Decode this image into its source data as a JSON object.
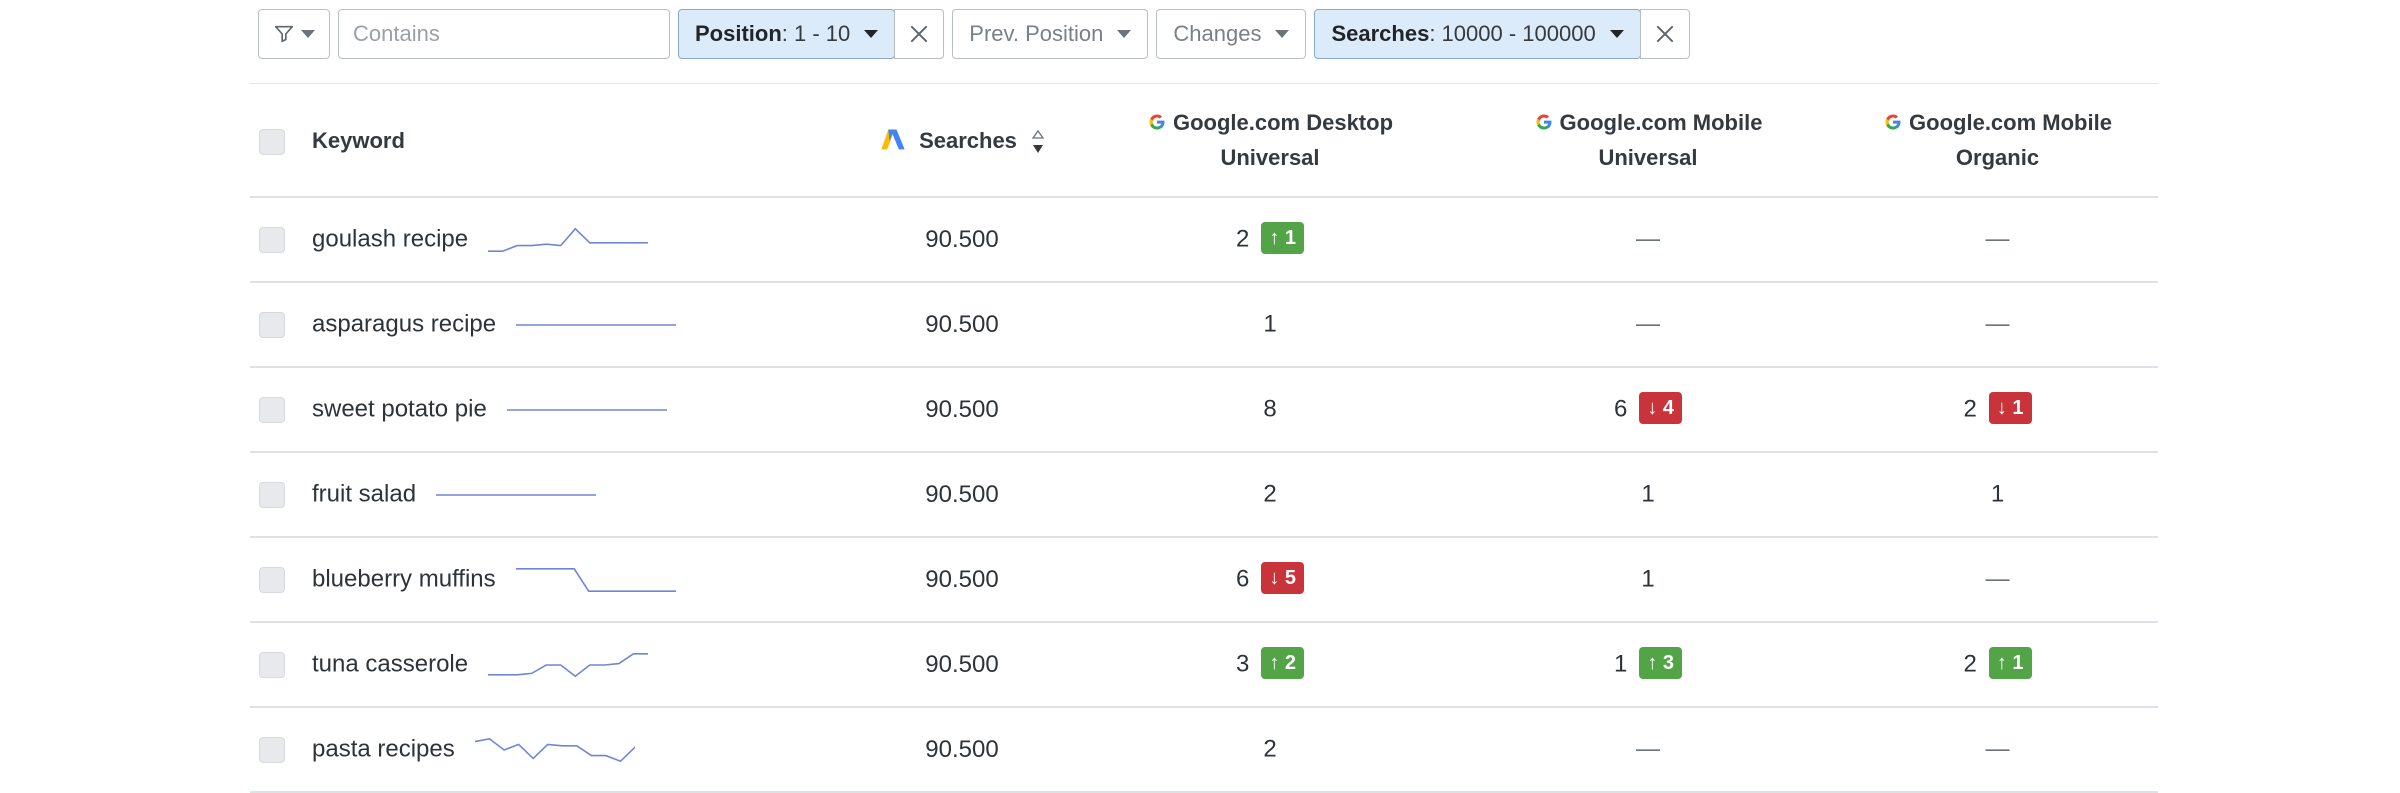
{
  "filters": {
    "contains_placeholder": "Contains",
    "position": {
      "label": "Position",
      "value": ": 1 - 10"
    },
    "prev_position": "Prev. Position",
    "changes": "Changes",
    "searches": {
      "label": "Searches",
      "value": ": 10000 - 100000"
    }
  },
  "columns": {
    "keyword": "Keyword",
    "searches": "Searches",
    "desktop_universal": [
      "Google.com Desktop",
      "Universal"
    ],
    "mobile_universal": [
      "Google.com Mobile",
      "Universal"
    ],
    "mobile_organic": [
      "Google.com Mobile",
      "Organic"
    ]
  },
  "rows": [
    {
      "keyword": "goulash recipe",
      "searches": "90.500",
      "desktop": {
        "pos": "2",
        "change": "1",
        "dir": "up"
      },
      "mobile": {
        "pos": "—"
      },
      "organic": {
        "pos": "—"
      },
      "trend": [
        0.1,
        0.1,
        0.3,
        0.3,
        0.35,
        0.3,
        0.9,
        0.4,
        0.4,
        0.4,
        0.4,
        0.4
      ]
    },
    {
      "keyword": "asparagus recipe",
      "searches": "90.500",
      "desktop": {
        "pos": "1"
      },
      "mobile": {
        "pos": "—"
      },
      "organic": {
        "pos": "—"
      },
      "trend": [
        0.5,
        0.5,
        0.5,
        0.5,
        0.5,
        0.5,
        0.5,
        0.5,
        0.5,
        0.5,
        0.5,
        0.5
      ]
    },
    {
      "keyword": "sweet potato pie",
      "searches": "90.500",
      "desktop": {
        "pos": "8"
      },
      "mobile": {
        "pos": "6",
        "change": "4",
        "dir": "down"
      },
      "organic": {
        "pos": "2",
        "change": "1",
        "dir": "down"
      },
      "trend": [
        0.5,
        0.5,
        0.5,
        0.5,
        0.5,
        0.5,
        0.5,
        0.5,
        0.5,
        0.5,
        0.5,
        0.5
      ]
    },
    {
      "keyword": "fruit salad",
      "searches": "90.500",
      "desktop": {
        "pos": "2"
      },
      "mobile": {
        "pos": "1"
      },
      "organic": {
        "pos": "1"
      },
      "trend": [
        0.5,
        0.5,
        0.5,
        0.5,
        0.5,
        0.5,
        0.5,
        0.5,
        0.5,
        0.5,
        0.5,
        0.5
      ]
    },
    {
      "keyword": "blueberry muffins",
      "searches": "90.500",
      "desktop": {
        "pos": "6",
        "change": "5",
        "dir": "down"
      },
      "mobile": {
        "pos": "1"
      },
      "organic": {
        "pos": "—"
      },
      "trend": [
        0.9,
        0.9,
        0.9,
        0.9,
        0.9,
        0.1,
        0.1,
        0.1,
        0.1,
        0.1,
        0.1,
        0.1
      ]
    },
    {
      "keyword": "tuna casserole",
      "searches": "90.500",
      "desktop": {
        "pos": "3",
        "change": "2",
        "dir": "up"
      },
      "mobile": {
        "pos": "1",
        "change": "3",
        "dir": "up"
      },
      "organic": {
        "pos": "2",
        "change": "1",
        "dir": "up"
      },
      "trend": [
        0.15,
        0.15,
        0.15,
        0.2,
        0.5,
        0.5,
        0.1,
        0.5,
        0.5,
        0.55,
        0.9,
        0.9
      ]
    },
    {
      "keyword": "pasta recipes",
      "searches": "90.500",
      "desktop": {
        "pos": "2"
      },
      "mobile": {
        "pos": "—"
      },
      "organic": {
        "pos": "—"
      },
      "trend": [
        0.8,
        0.9,
        0.5,
        0.7,
        0.2,
        0.7,
        0.65,
        0.65,
        0.3,
        0.3,
        0.1,
        0.6
      ]
    }
  ],
  "colors": {
    "up": "#52a447",
    "down": "#c9343b",
    "sparkline": "#6f86d6",
    "active_filter": "#dcebfa"
  },
  "icons": {
    "funnel": "filter-icon",
    "close": "close-icon",
    "google": "google-icon",
    "ads": "google-ads-icon",
    "sort": "sort-icon"
  }
}
